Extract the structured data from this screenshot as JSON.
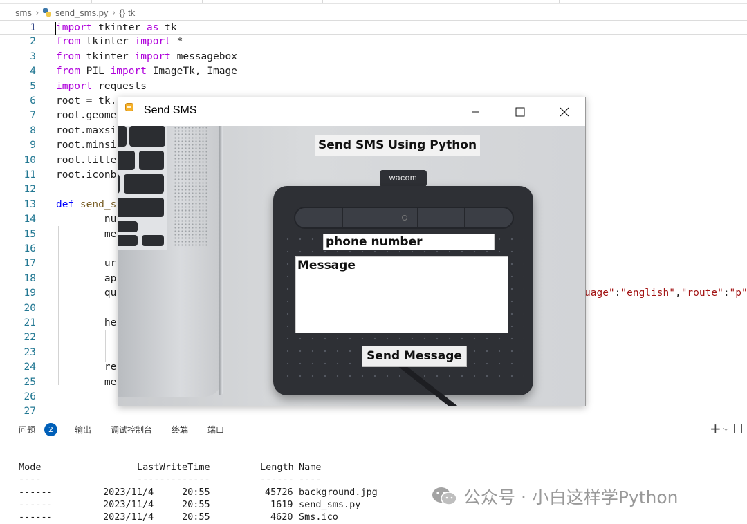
{
  "breadcrumb": {
    "folder": "sms",
    "file": "send_sms.py",
    "symbol": "tk"
  },
  "editor": {
    "lines": [
      {
        "num": "1",
        "segs": [
          [
            "kw",
            "import"
          ],
          [
            "",
            " tkinter "
          ],
          [
            "kw",
            "as"
          ],
          [
            "",
            " tk"
          ]
        ]
      },
      {
        "num": "2",
        "segs": [
          [
            "kw",
            "from"
          ],
          [
            "",
            " tkinter "
          ],
          [
            "kw",
            "import"
          ],
          [
            "",
            " *"
          ]
        ]
      },
      {
        "num": "3",
        "segs": [
          [
            "kw",
            "from"
          ],
          [
            "",
            " tkinter "
          ],
          [
            "kw",
            "import"
          ],
          [
            "",
            " messagebox"
          ]
        ]
      },
      {
        "num": "4",
        "segs": [
          [
            "kw",
            "from"
          ],
          [
            "",
            " PIL "
          ],
          [
            "kw",
            "import"
          ],
          [
            "",
            " ImageTk, Image"
          ]
        ]
      },
      {
        "num": "5",
        "segs": [
          [
            "kw",
            "import"
          ],
          [
            "",
            " requests"
          ]
        ]
      },
      {
        "num": "6",
        "segs": [
          [
            "",
            "root = tk."
          ]
        ]
      },
      {
        "num": "7",
        "segs": [
          [
            "",
            "root.geome"
          ]
        ]
      },
      {
        "num": "8",
        "segs": [
          [
            "",
            "root.maxsi"
          ]
        ]
      },
      {
        "num": "9",
        "segs": [
          [
            "",
            "root.minsi"
          ]
        ]
      },
      {
        "num": "10",
        "segs": [
          [
            "",
            "root.title"
          ]
        ]
      },
      {
        "num": "11",
        "segs": [
          [
            "",
            "root.iconb"
          ]
        ]
      },
      {
        "num": "12",
        "segs": []
      },
      {
        "num": "13",
        "segs": [
          [
            "kw2",
            "def"
          ],
          [
            "fn",
            " send_s"
          ]
        ]
      },
      {
        "num": "14",
        "segs": [
          [
            "",
            "        nu"
          ]
        ]
      },
      {
        "num": "15",
        "segs": [
          [
            "",
            "        me"
          ]
        ]
      },
      {
        "num": "16",
        "segs": []
      },
      {
        "num": "17",
        "segs": [
          [
            "",
            "        ur"
          ]
        ]
      },
      {
        "num": "18",
        "segs": [
          [
            "",
            "        ap"
          ]
        ]
      },
      {
        "num": "19",
        "segs": [
          [
            "",
            "        qu"
          ]
        ]
      },
      {
        "num": "20",
        "segs": []
      },
      {
        "num": "21",
        "segs": [
          [
            "",
            "        he"
          ]
        ]
      },
      {
        "num": "22",
        "segs": []
      },
      {
        "num": "23",
        "segs": []
      },
      {
        "num": "24",
        "segs": [
          [
            "",
            "        re"
          ]
        ]
      },
      {
        "num": "25",
        "segs": [
          [
            "",
            "        me"
          ]
        ]
      },
      {
        "num": "26",
        "segs": []
      },
      {
        "num": "27",
        "segs": []
      }
    ],
    "line19_tail": [
      [
        "str",
        "uage\""
      ],
      [
        "",
        ":"
      ],
      [
        "str",
        "\"english\""
      ],
      [
        "",
        ","
      ],
      [
        "str",
        "\"route\""
      ],
      [
        "",
        ":"
      ],
      [
        "str",
        "\"p\""
      ],
      [
        "",
        ","
      ]
    ]
  },
  "tk_window": {
    "title": "Send SMS",
    "heading": "Send SMS Using Python",
    "phone_entry": "phone number",
    "message_text": "Message",
    "send_button": "Send Message",
    "brand": "wacom"
  },
  "panel": {
    "tabs": [
      "问题",
      "输出",
      "调试控制台",
      "终端",
      "端口"
    ],
    "problems_count": "2",
    "active_tab": "终端"
  },
  "terminal": {
    "headers": {
      "mode": "Mode",
      "time": "LastWriteTime",
      "length": "Length",
      "name": "Name"
    },
    "underline": {
      "mode": "----",
      "time": "-------------",
      "length": "------",
      "name": "----"
    },
    "rows": [
      {
        "mode": "------",
        "date": "2023/11/4",
        "time": "20:55",
        "length": "45726",
        "name": "background.jpg"
      },
      {
        "mode": "------",
        "date": "2023/11/4",
        "time": "20:55",
        "length": "1619",
        "name": "send_sms.py"
      },
      {
        "mode": "------",
        "date": "2023/11/4",
        "time": "20:55",
        "length": "4620",
        "name": "Sms.ico"
      }
    ]
  },
  "watermark": {
    "text": "公众号 · 小白这样学Python"
  },
  "colors": {
    "accent": "#005fb8",
    "keyword": "#af00db",
    "string": "#a31515",
    "line_number": "#237893"
  }
}
